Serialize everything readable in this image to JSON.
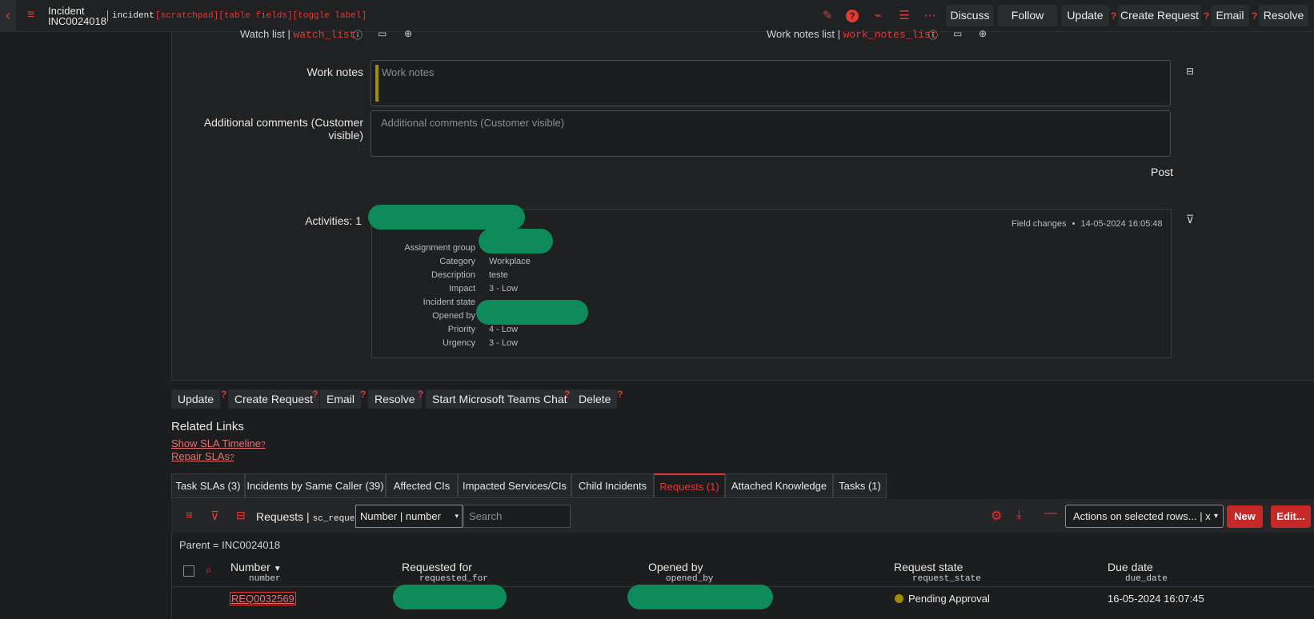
{
  "header": {
    "title": "Incident",
    "number": "INC0024018",
    "table": "incident",
    "debug_tags": "[scratchpad][table fields][toggle label]",
    "buttons": {
      "discuss": "Discuss",
      "follow": "Follow",
      "update": "Update",
      "create_request": "Create Request",
      "email": "Email",
      "resolve": "Resolve"
    },
    "help_mark": "?"
  },
  "form": {
    "watch_list_label": "Watch list |",
    "watch_list_field": "watch_list",
    "work_notes_list_label": "Work notes list |",
    "work_notes_list_field": "work_notes_list",
    "work_notes_label": "Work notes",
    "work_notes_placeholder": "Work notes",
    "additional_comments_label": "Additional comments (Customer visible)",
    "additional_comments_placeholder": "Additional comments (Customer visible)",
    "post_label": "Post",
    "activities_label": "Activities: 1"
  },
  "activity": {
    "meta_type": "Field changes",
    "meta_dot": "•",
    "timestamp": "14-05-2024 16:05:48",
    "changes": [
      {
        "label": "Assignment group",
        "value": ""
      },
      {
        "label": "Category",
        "value": "Workplace"
      },
      {
        "label": "Description",
        "value": "teste"
      },
      {
        "label": "Impact",
        "value": "3 - Low"
      },
      {
        "label": "Incident state",
        "value": ""
      },
      {
        "label": "Opened by",
        "value": ""
      },
      {
        "label": "Priority",
        "value": "4 - Low"
      },
      {
        "label": "Urgency",
        "value": "3 - Low"
      }
    ]
  },
  "actions": {
    "update": "Update",
    "create_request": "Create Request",
    "email": "Email",
    "resolve": "Resolve",
    "teams_chat": "Start Microsoft Teams Chat",
    "delete": "Delete"
  },
  "related_links": {
    "title": "Related Links",
    "show_sla_timeline": "Show SLA Timeline",
    "repair_slas": "Repair SLAs",
    "help_mark": "?"
  },
  "tabs": [
    {
      "label": "Task SLAs (3)"
    },
    {
      "label": "Incidents by Same Caller (39)"
    },
    {
      "label": "Affected CIs"
    },
    {
      "label": "Impacted Services/CIs"
    },
    {
      "label": "Child Incidents"
    },
    {
      "label": "Requests (1)"
    },
    {
      "label": "Attached Knowledge"
    },
    {
      "label": "Tasks (1)"
    }
  ],
  "list": {
    "title": "Requests |",
    "table": "sc_request",
    "search_field_selected": "Number | number",
    "search_placeholder": "Search",
    "actions_select": "Actions on selected rows... | x",
    "new_button": "New",
    "edit_button": "Edit...",
    "breadcrumb": "Parent = INC0024018",
    "columns": [
      {
        "title": "Number",
        "field": "number",
        "sort": "▼"
      },
      {
        "title": "Requested for",
        "field": "requested_for"
      },
      {
        "title": "Opened by",
        "field": "opened_by"
      },
      {
        "title": "Request state",
        "field": "request_state"
      },
      {
        "title": "Due date",
        "field": "due_date"
      }
    ],
    "rows": [
      {
        "number": "REQ0032569",
        "requested_for": "",
        "opened_by": "",
        "request_state": "Pending Approval",
        "due_date": "16-05-2024 16:07:45"
      }
    ]
  },
  "colors": {
    "accent": "#e53935",
    "background": "#1b1d1e",
    "redaction": "#0f8a5b",
    "state_dot": "#a08c00"
  }
}
